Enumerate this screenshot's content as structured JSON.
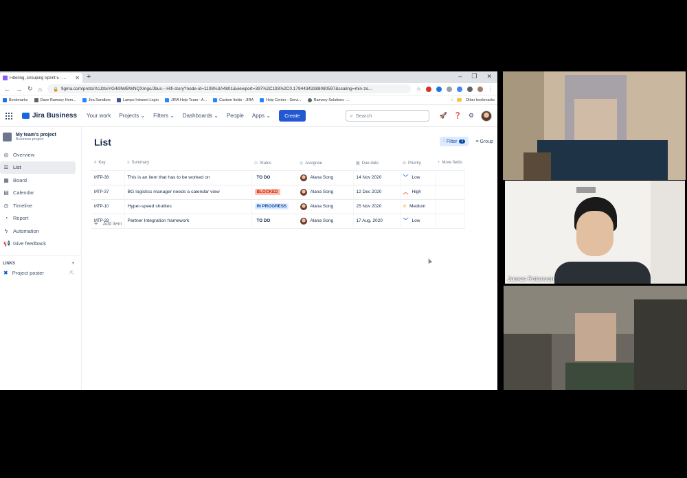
{
  "browser": {
    "tab_title": "Filtering, Grouping Sprint 5 - ...",
    "url": "figma.com/proto/XcJzlxiYG4i9lWBWNQXmgc/Jbus---Hifi-story?node-id=1108%3A4801&viewport=397%2C193%2C0.17944343388080597&scaling=min-zo...",
    "bookmarks": [
      "Bookmarks",
      "Dave Ramsey Hom...",
      "Jira Sandbox",
      "Lampo Intranet Login",
      "JIRA Help Team - A...",
      "Custom fields - JIRA",
      "Help Center - Servi...",
      "Ramsey Solutions -..."
    ],
    "other_bookmarks": "Other bookmarks"
  },
  "jira": {
    "brand": "Jira Business",
    "nav": [
      "Your work",
      "Projects",
      "Filters",
      "Dashboards",
      "People",
      "Apps"
    ],
    "nav_dropdown": [
      "",
      "⌄",
      "⌄",
      "⌄",
      "",
      "⌄"
    ],
    "create": "Create",
    "search_placeholder": "Search",
    "project_name": "My team's project",
    "project_type": "Business project",
    "sidebar": [
      "Overview",
      "List",
      "Board",
      "Calendar",
      "Timeline",
      "Report",
      "Automation",
      "Give feedback"
    ],
    "links_head": "LINKS",
    "link_item": "Project poster",
    "page_title": "List",
    "filter_label": "Filter",
    "filter_count": "1",
    "group_label": "Group",
    "columns": [
      "Key",
      "Summary",
      "Status",
      "Assignee",
      "Due date",
      "Priority",
      "More fields"
    ],
    "rows": [
      {
        "key": "MTP-38",
        "summary": "This is an item that has to be worked on",
        "status": "TO DO",
        "assignee": "Alana Song",
        "due": "14 Nov 2020",
        "priority": "Low"
      },
      {
        "key": "MTP-37",
        "summary": "BG logistics manager needs a calendar view",
        "status": "BLOCKED",
        "assignee": "Alana Song",
        "due": "12 Dec 2020",
        "priority": "High"
      },
      {
        "key": "MTP-10",
        "summary": "Hyper-speed shuttles",
        "status": "IN PROGRESS",
        "assignee": "Alana Song",
        "due": "25 Nov 2020",
        "priority": "Medium"
      },
      {
        "key": "MTP-28",
        "summary": "Partner Integration framework",
        "status": "TO DO",
        "assignee": "Alana Song",
        "due": "17 Aug, 2020",
        "priority": "Low"
      }
    ],
    "add_item": "Add item"
  },
  "colors": {
    "status": {
      "TO DO": [
        "#ffffff",
        "#172b4d"
      ],
      "BLOCKED": [
        "#ffbdad",
        "#bf2600"
      ],
      "IN PROGRESS": [
        "#deebff",
        "#0747a6"
      ]
    },
    "priority": {
      "Low": [
        "﹀",
        "#2684ff"
      ],
      "High": [
        "︿",
        "#ff5630"
      ],
      "Medium": [
        "=",
        "#ffab00"
      ]
    }
  },
  "participants": [
    {
      "name": ""
    },
    {
      "name": "James Rotanson"
    },
    {
      "name": ""
    }
  ]
}
